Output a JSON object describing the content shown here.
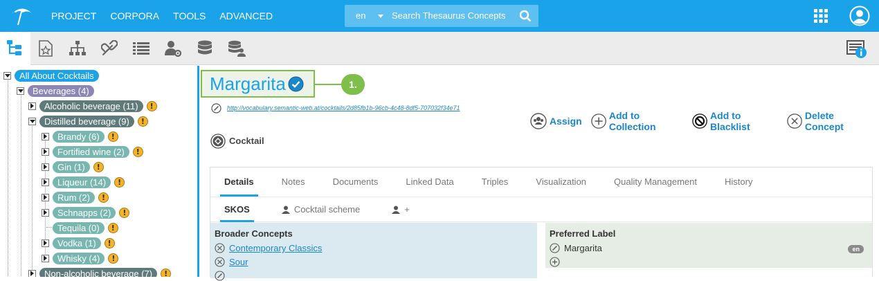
{
  "topbar": {
    "menu": [
      "PROJECT",
      "CORPORA",
      "TOOLS",
      "ADVANCED"
    ],
    "search": {
      "language": "en",
      "placeholder": "Search Thesaurus Concepts"
    }
  },
  "tree": {
    "root": "All About Cocktails",
    "beverages": "Beverages (4)",
    "alcoholic": "Alcoholic beverage (11)",
    "distilled": "Distilled beverage (9)",
    "children": [
      "Brandy (6)",
      "Fortified wine (2)",
      "Gin (1)",
      "Liqueur (14)",
      "Rum (2)",
      "Schnapps (2)",
      "Tequila (0)",
      "Vodka (1)",
      "Whisky (4)"
    ],
    "nonalcoholic": "Non-alcoholic beverage (7)",
    "warning_glyph": "!"
  },
  "concept": {
    "title": "Margarita",
    "uri": "http://vocabulary.semantic-web.at/cocktails/2d85fb1b-96cb-4c48-8df5-707032f34e71",
    "type": "Cocktail",
    "callout": "1."
  },
  "actions": {
    "assign": "Assign",
    "add_to_collection": "Add to Collection",
    "add_to_blacklist": "Add to Blacklist",
    "delete_concept": "Delete Concept"
  },
  "tabs": [
    "Details",
    "Notes",
    "Documents",
    "Linked Data",
    "Triples",
    "Visualization",
    "Quality Management",
    "History"
  ],
  "subtabs": {
    "skos": "SKOS",
    "scheme": "Cocktail scheme",
    "add": "+"
  },
  "broader": {
    "title": "Broader Concepts",
    "items": [
      "Contemporary Classics",
      "Sour"
    ]
  },
  "preferred": {
    "title": "Preferred Label",
    "value": "Margarita",
    "lang": "en"
  },
  "colors": {
    "accent": "#1aa3e8",
    "callout": "#7dbf4a",
    "warning": "#f3b42b"
  }
}
